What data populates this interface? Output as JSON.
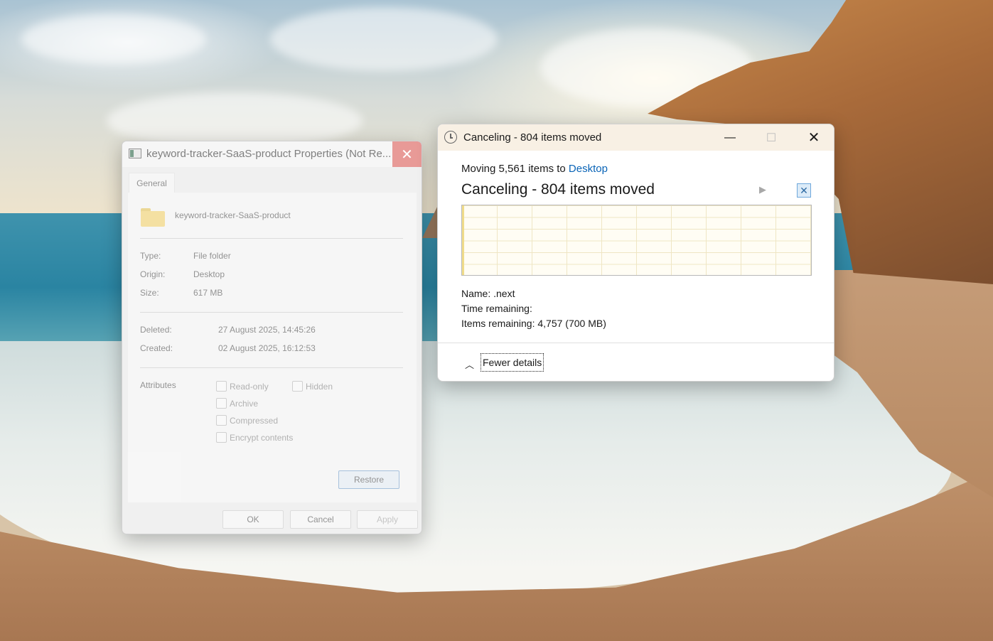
{
  "properties_dialog": {
    "title": "keyword-tracker-SaaS-product Properties (Not Re...",
    "tab_general": "General",
    "folder_name": "keyword-tracker-SaaS-product",
    "type_label": "Type:",
    "type_value": "File folder",
    "origin_label": "Origin:",
    "origin_value": "Desktop",
    "size_label": "Size:",
    "size_value": "617 MB",
    "deleted_label": "Deleted:",
    "deleted_value": "27 August 2025, 14:45:26",
    "created_label": "Created:",
    "created_value": "02 August 2025, 16:12:53",
    "attributes_label": "Attributes",
    "attr_readonly": "Read-only",
    "attr_hidden": "Hidden",
    "attr_archive": "Archive",
    "attr_compressed": "Compressed",
    "attr_encrypt": "Encrypt contents",
    "restore_label": "Restore",
    "ok_label": "OK",
    "cancel_label": "Cancel",
    "apply_label": "Apply"
  },
  "progress_dialog": {
    "title": "Canceling - 804 items moved",
    "moving_prefix": "Moving 5,561 items to",
    "moving_destination": "Desktop",
    "status": "Canceling - 804 items moved",
    "progress_fraction": 0.006,
    "name_label": "Name:",
    "name_value": ".next",
    "time_label": "Time remaining:",
    "time_value": "",
    "items_label": "Items remaining:",
    "items_value": "4,757 (700 MB)",
    "fewer_details_label": "Fewer details"
  },
  "icons": {
    "props_app_icon": "properties-window-icon",
    "folder": "folder-icon",
    "clock": "clock-icon",
    "minimize": "minimize-icon",
    "maximize": "maximize-icon",
    "close": "close-icon",
    "play": "play-icon",
    "stop": "stop-icon",
    "chevron": "chevron-up-icon"
  },
  "colors": {
    "link_blue": "#0a64b7",
    "close_hover_red": "#e89a97",
    "graph_fill": "#f0dc8a"
  }
}
